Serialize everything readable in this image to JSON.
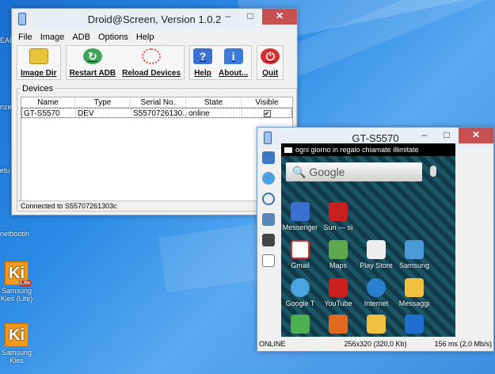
{
  "desktop": {
    "fragments": [
      "EAE",
      "nze",
      "etu",
      "netbootin"
    ],
    "icon_kies_lite": {
      "line1": "Samsung",
      "line2": "Kies (Lite)",
      "logo": "Ki",
      "badge": "Lite"
    },
    "icon_kies": {
      "line1": "Samsung",
      "line2": "Kies",
      "logo": "Ki"
    }
  },
  "main_window": {
    "title": "Droid@Screen, Version 1.0.2",
    "menu": [
      "File",
      "Image",
      "ADB",
      "Options",
      "Help"
    ],
    "toolbar": {
      "image_dir": "Image Dir",
      "restart_adb": "Restart ADB",
      "reload_devices": "Reload Devices",
      "help": "Help",
      "about": "About...",
      "quit": "Quit",
      "help_glyph": "?",
      "about_glyph": "i",
      "quit_glyph": "⏻"
    },
    "devices_label": "Devices",
    "columns": [
      "Name",
      "Type",
      "Serial No.",
      "State",
      "Visible"
    ],
    "rows": [
      {
        "name": "GT-S5570",
        "type": "DEV",
        "serial": "S5570726130...",
        "state": "online",
        "visible": "✔"
      }
    ],
    "status": "Connected to S55707261303c"
  },
  "device_window": {
    "title": "GT-S5570",
    "notification": "ogni giorno in regalo chiamate illimitate",
    "search_label": "Google",
    "apps": [
      "Messenger",
      "Sun — sì",
      "Gmail",
      "Maps",
      "Play Store",
      "Samsung",
      "Google T",
      "YouTube",
      "Internet",
      "Messaggi"
    ],
    "status_left": "ONLINE",
    "status_mid": "256x320 (320,0 Kb)",
    "status_right": "156 ms (2,0 Mb/s)"
  },
  "colors": {
    "titlebar_close": "#c75050",
    "desktop": "#2b8be6",
    "kies_orange": "#f39a1e"
  }
}
